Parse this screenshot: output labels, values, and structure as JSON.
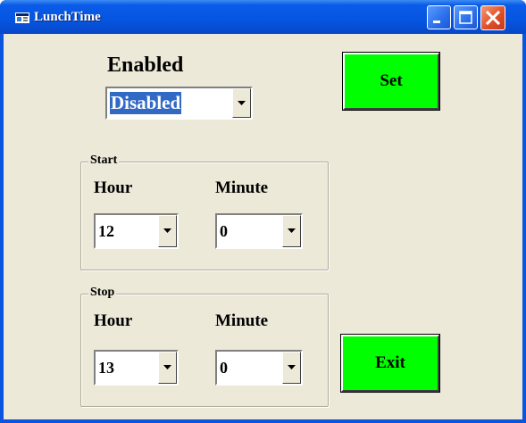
{
  "window": {
    "title": "LunchTime"
  },
  "enabled": {
    "label": "Enabled",
    "value": "Disabled"
  },
  "set_button": "Set",
  "exit_button": "Exit",
  "start": {
    "group_label": "Start",
    "hour_label": "Hour",
    "minute_label": "Minute",
    "hour_value": "12",
    "minute_value": "0"
  },
  "stop": {
    "group_label": "Stop",
    "hour_label": "Hour",
    "minute_label": "Minute",
    "hour_value": "13",
    "minute_value": "0"
  },
  "colors": {
    "titlebar": "#0555e0",
    "client_background": "#ece9d8",
    "button_green": "#00ff00",
    "selection_blue": "#316ac5"
  },
  "icons": [
    "app-icon",
    "minimize-icon",
    "maximize-icon",
    "close-icon",
    "dropdown-arrow-icon"
  ]
}
